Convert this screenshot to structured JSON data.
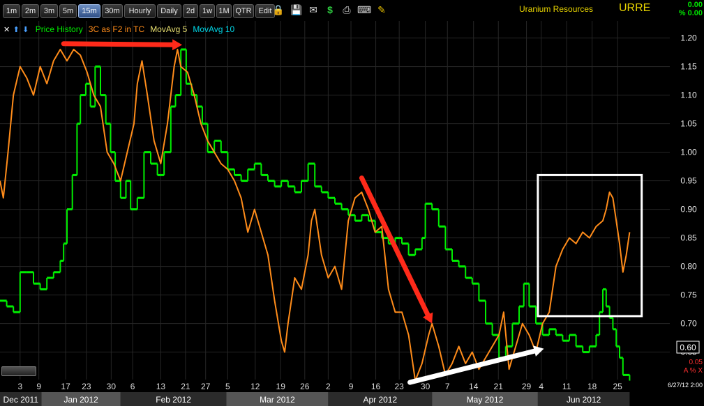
{
  "toolbar": {
    "intervals": [
      {
        "label": "1m"
      },
      {
        "label": "2m"
      },
      {
        "label": "3m"
      },
      {
        "label": "5m"
      },
      {
        "label": "15m",
        "active": true
      },
      {
        "label": "30m"
      },
      {
        "label": "Hourly"
      },
      {
        "label": "Daily"
      },
      {
        "label": "2d"
      },
      {
        "label": "1w"
      },
      {
        "label": "1M"
      },
      {
        "label": "QTR"
      },
      {
        "label": "Edit"
      }
    ],
    "icons": [
      "lock-icon",
      "save-icon",
      "email-icon",
      "dollar-icon",
      "print-icon",
      "keyboard-icon",
      "pencil-icon"
    ]
  },
  "header": {
    "company": "Uranium Resources",
    "symbol": "URRE",
    "change": "0.00",
    "change_pct": "% 0.00"
  },
  "legend": {
    "items": [
      {
        "label": "Price History",
        "color": "#00ee00"
      },
      {
        "label": "3C as F2 in TC",
        "color": "#ff8c1a"
      },
      {
        "label": "MovAvg 5",
        "color": "#e8e070"
      },
      {
        "label": "MovAvg 10",
        "color": "#00d8e8"
      }
    ]
  },
  "corner": {
    "value": "0.05",
    "controls": "A % X"
  },
  "datestamp": "6/27/12 2:00",
  "chart_data": {
    "type": "line",
    "title": "",
    "ylim": [
      0.58,
      1.23
    ],
    "y_ticks": [
      1.2,
      1.15,
      1.1,
      1.05,
      1.0,
      0.95,
      0.9,
      0.85,
      0.8,
      0.75,
      0.7,
      0.65
    ],
    "last_price": "0.60",
    "x_ticks": [
      {
        "label": "3",
        "t": 0.03
      },
      {
        "label": "9",
        "t": 0.058
      },
      {
        "label": "17",
        "t": 0.098
      },
      {
        "label": "23",
        "t": 0.129
      },
      {
        "label": "30",
        "t": 0.166
      },
      {
        "label": "6",
        "t": 0.198
      },
      {
        "label": "13",
        "t": 0.24
      },
      {
        "label": "21",
        "t": 0.277
      },
      {
        "label": "27",
        "t": 0.307
      },
      {
        "label": "5",
        "t": 0.34
      },
      {
        "label": "12",
        "t": 0.381
      },
      {
        "label": "19",
        "t": 0.419
      },
      {
        "label": "26",
        "t": 0.455
      },
      {
        "label": "2",
        "t": 0.49
      },
      {
        "label": "9",
        "t": 0.524
      },
      {
        "label": "16",
        "t": 0.561
      },
      {
        "label": "23",
        "t": 0.596
      },
      {
        "label": "30",
        "t": 0.635
      },
      {
        "label": "7",
        "t": 0.668
      },
      {
        "label": "14",
        "t": 0.707
      },
      {
        "label": "21",
        "t": 0.744
      },
      {
        "label": "29",
        "t": 0.786
      },
      {
        "label": "4",
        "t": 0.808
      },
      {
        "label": "11",
        "t": 0.846
      },
      {
        "label": "18",
        "t": 0.884
      },
      {
        "label": "25",
        "t": 0.922
      }
    ],
    "months": [
      {
        "label": "Dec 2011",
        "t0": 0.0,
        "t1": 0.062
      },
      {
        "label": "Jan 2012",
        "t0": 0.062,
        "t1": 0.18
      },
      {
        "label": "Feb 2012",
        "t0": 0.18,
        "t1": 0.338
      },
      {
        "label": "Mar 2012",
        "t0": 0.338,
        "t1": 0.49
      },
      {
        "label": "Apr 2012",
        "t0": 0.49,
        "t1": 0.645
      },
      {
        "label": "May 2012",
        "t0": 0.645,
        "t1": 0.803
      },
      {
        "label": "Jun 2012",
        "t0": 0.803,
        "t1": 0.94
      }
    ],
    "series": [
      {
        "name": "Price History",
        "color": "#00ee00",
        "points": [
          [
            0.0,
            0.74
          ],
          [
            0.01,
            0.73
          ],
          [
            0.02,
            0.72
          ],
          [
            0.03,
            0.79
          ],
          [
            0.04,
            0.79
          ],
          [
            0.05,
            0.77
          ],
          [
            0.06,
            0.76
          ],
          [
            0.07,
            0.78
          ],
          [
            0.08,
            0.79
          ],
          [
            0.09,
            0.81
          ],
          [
            0.095,
            0.84
          ],
          [
            0.1,
            0.9
          ],
          [
            0.108,
            0.96
          ],
          [
            0.115,
            1.05
          ],
          [
            0.12,
            1.1
          ],
          [
            0.128,
            1.12
          ],
          [
            0.135,
            1.08
          ],
          [
            0.142,
            1.15
          ],
          [
            0.15,
            1.1
          ],
          [
            0.158,
            1.05
          ],
          [
            0.165,
            1.0
          ],
          [
            0.172,
            0.95
          ],
          [
            0.18,
            0.92
          ],
          [
            0.188,
            0.95
          ],
          [
            0.195,
            0.9
          ],
          [
            0.205,
            0.92
          ],
          [
            0.215,
            1.0
          ],
          [
            0.225,
            0.98
          ],
          [
            0.235,
            0.96
          ],
          [
            0.245,
            1.0
          ],
          [
            0.255,
            1.08
          ],
          [
            0.262,
            1.1
          ],
          [
            0.27,
            1.18
          ],
          [
            0.278,
            1.12
          ],
          [
            0.286,
            1.1
          ],
          [
            0.294,
            1.08
          ],
          [
            0.302,
            1.05
          ],
          [
            0.31,
            1.0
          ],
          [
            0.32,
            1.02
          ],
          [
            0.33,
            1.0
          ],
          [
            0.34,
            0.97
          ],
          [
            0.35,
            0.96
          ],
          [
            0.36,
            0.95
          ],
          [
            0.37,
            0.97
          ],
          [
            0.38,
            0.98
          ],
          [
            0.39,
            0.96
          ],
          [
            0.4,
            0.95
          ],
          [
            0.41,
            0.94
          ],
          [
            0.42,
            0.95
          ],
          [
            0.43,
            0.94
          ],
          [
            0.44,
            0.93
          ],
          [
            0.45,
            0.95
          ],
          [
            0.46,
            0.98
          ],
          [
            0.47,
            0.94
          ],
          [
            0.48,
            0.93
          ],
          [
            0.49,
            0.92
          ],
          [
            0.5,
            0.91
          ],
          [
            0.51,
            0.9
          ],
          [
            0.52,
            0.89
          ],
          [
            0.53,
            0.88
          ],
          [
            0.54,
            0.89
          ],
          [
            0.55,
            0.88
          ],
          [
            0.56,
            0.86
          ],
          [
            0.57,
            0.85
          ],
          [
            0.58,
            0.84
          ],
          [
            0.59,
            0.85
          ],
          [
            0.6,
            0.84
          ],
          [
            0.61,
            0.82
          ],
          [
            0.62,
            0.83
          ],
          [
            0.63,
            0.85
          ],
          [
            0.635,
            0.91
          ],
          [
            0.645,
            0.9
          ],
          [
            0.655,
            0.87
          ],
          [
            0.665,
            0.83
          ],
          [
            0.675,
            0.81
          ],
          [
            0.685,
            0.8
          ],
          [
            0.695,
            0.78
          ],
          [
            0.705,
            0.77
          ],
          [
            0.715,
            0.74
          ],
          [
            0.725,
            0.7
          ],
          [
            0.735,
            0.68
          ],
          [
            0.745,
            0.64
          ],
          [
            0.755,
            0.66
          ],
          [
            0.765,
            0.7
          ],
          [
            0.775,
            0.73
          ],
          [
            0.782,
            0.77
          ],
          [
            0.79,
            0.73
          ],
          [
            0.8,
            0.7
          ],
          [
            0.81,
            0.68
          ],
          [
            0.82,
            0.69
          ],
          [
            0.83,
            0.68
          ],
          [
            0.84,
            0.67
          ],
          [
            0.85,
            0.68
          ],
          [
            0.86,
            0.66
          ],
          [
            0.87,
            0.65
          ],
          [
            0.88,
            0.66
          ],
          [
            0.89,
            0.68
          ],
          [
            0.895,
            0.72
          ],
          [
            0.9,
            0.76
          ],
          [
            0.905,
            0.73
          ],
          [
            0.91,
            0.71
          ],
          [
            0.915,
            0.69
          ],
          [
            0.92,
            0.66
          ],
          [
            0.925,
            0.64
          ],
          [
            0.93,
            0.61
          ],
          [
            0.94,
            0.6
          ]
        ]
      },
      {
        "name": "3C as F2 in TC",
        "color": "#ff8c1a",
        "points": [
          [
            0.0,
            0.95
          ],
          [
            0.005,
            0.92
          ],
          [
            0.012,
            1.0
          ],
          [
            0.02,
            1.1
          ],
          [
            0.03,
            1.15
          ],
          [
            0.04,
            1.13
          ],
          [
            0.05,
            1.1
          ],
          [
            0.06,
            1.15
          ],
          [
            0.07,
            1.12
          ],
          [
            0.08,
            1.16
          ],
          [
            0.09,
            1.18
          ],
          [
            0.1,
            1.16
          ],
          [
            0.11,
            1.18
          ],
          [
            0.12,
            1.17
          ],
          [
            0.13,
            1.14
          ],
          [
            0.14,
            1.1
          ],
          [
            0.15,
            1.08
          ],
          [
            0.16,
            1.0
          ],
          [
            0.17,
            0.98
          ],
          [
            0.18,
            0.95
          ],
          [
            0.19,
            1.0
          ],
          [
            0.2,
            1.05
          ],
          [
            0.205,
            1.12
          ],
          [
            0.212,
            1.16
          ],
          [
            0.22,
            1.1
          ],
          [
            0.23,
            1.02
          ],
          [
            0.24,
            0.98
          ],
          [
            0.25,
            1.05
          ],
          [
            0.26,
            1.15
          ],
          [
            0.265,
            1.18
          ],
          [
            0.27,
            1.15
          ],
          [
            0.28,
            1.14
          ],
          [
            0.29,
            1.1
          ],
          [
            0.3,
            1.05
          ],
          [
            0.31,
            1.02
          ],
          [
            0.32,
            1.0
          ],
          [
            0.33,
            0.98
          ],
          [
            0.34,
            0.97
          ],
          [
            0.35,
            0.95
          ],
          [
            0.36,
            0.92
          ],
          [
            0.37,
            0.86
          ],
          [
            0.38,
            0.9
          ],
          [
            0.39,
            0.86
          ],
          [
            0.4,
            0.82
          ],
          [
            0.41,
            0.74
          ],
          [
            0.42,
            0.67
          ],
          [
            0.425,
            0.65
          ],
          [
            0.43,
            0.7
          ],
          [
            0.44,
            0.78
          ],
          [
            0.45,
            0.76
          ],
          [
            0.46,
            0.82
          ],
          [
            0.465,
            0.88
          ],
          [
            0.47,
            0.9
          ],
          [
            0.48,
            0.82
          ],
          [
            0.49,
            0.78
          ],
          [
            0.5,
            0.8
          ],
          [
            0.51,
            0.76
          ],
          [
            0.52,
            0.88
          ],
          [
            0.53,
            0.92
          ],
          [
            0.54,
            0.93
          ],
          [
            0.55,
            0.9
          ],
          [
            0.56,
            0.86
          ],
          [
            0.57,
            0.87
          ],
          [
            0.58,
            0.76
          ],
          [
            0.59,
            0.72
          ],
          [
            0.6,
            0.72
          ],
          [
            0.61,
            0.68
          ],
          [
            0.62,
            0.6
          ],
          [
            0.63,
            0.63
          ],
          [
            0.64,
            0.68
          ],
          [
            0.645,
            0.7
          ],
          [
            0.655,
            0.66
          ],
          [
            0.665,
            0.61
          ],
          [
            0.675,
            0.63
          ],
          [
            0.685,
            0.66
          ],
          [
            0.695,
            0.63
          ],
          [
            0.705,
            0.65
          ],
          [
            0.715,
            0.62
          ],
          [
            0.725,
            0.64
          ],
          [
            0.735,
            0.66
          ],
          [
            0.745,
            0.68
          ],
          [
            0.752,
            0.72
          ],
          [
            0.76,
            0.62
          ],
          [
            0.77,
            0.66
          ],
          [
            0.78,
            0.7
          ],
          [
            0.79,
            0.68
          ],
          [
            0.8,
            0.65
          ],
          [
            0.81,
            0.7
          ],
          [
            0.82,
            0.72
          ],
          [
            0.825,
            0.76
          ],
          [
            0.83,
            0.8
          ],
          [
            0.84,
            0.83
          ],
          [
            0.85,
            0.85
          ],
          [
            0.86,
            0.84
          ],
          [
            0.87,
            0.86
          ],
          [
            0.88,
            0.85
          ],
          [
            0.89,
            0.87
          ],
          [
            0.9,
            0.88
          ],
          [
            0.905,
            0.9
          ],
          [
            0.91,
            0.93
          ],
          [
            0.915,
            0.92
          ],
          [
            0.92,
            0.88
          ],
          [
            0.925,
            0.84
          ],
          [
            0.93,
            0.79
          ],
          [
            0.935,
            0.82
          ],
          [
            0.94,
            0.86
          ]
        ]
      }
    ],
    "annotations": [
      {
        "type": "arrow",
        "color": "#ff2a1a",
        "from": [
          0.095,
          1.19
        ],
        "to": [
          0.272,
          1.188
        ]
      },
      {
        "type": "arrow",
        "color": "#ff2a1a",
        "from": [
          0.54,
          0.955
        ],
        "to": [
          0.645,
          0.7
        ]
      },
      {
        "type": "arrow",
        "color": "#ffffff",
        "from": [
          0.612,
          0.597
        ],
        "to": [
          0.812,
          0.656
        ]
      },
      {
        "type": "box",
        "color": "#ffffff",
        "t0": 0.803,
        "t1": 0.958,
        "y0": 0.96,
        "y1": 0.713
      }
    ]
  }
}
